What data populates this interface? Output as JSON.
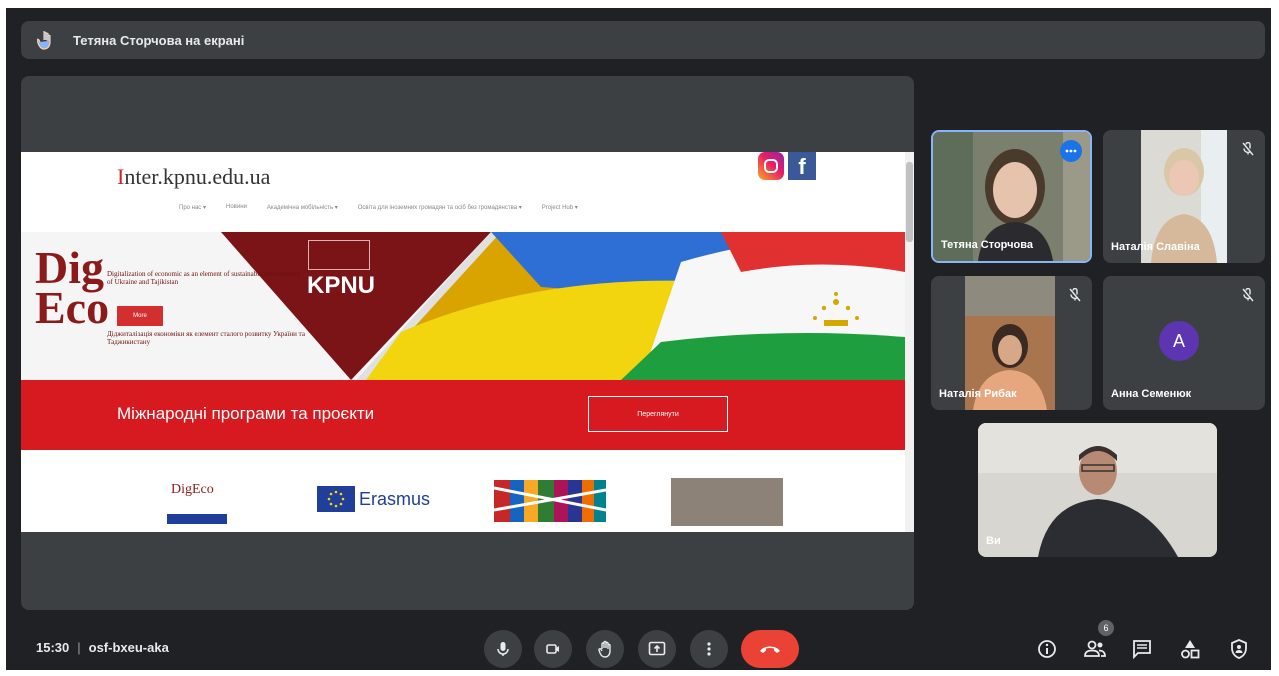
{
  "presentation": {
    "title": "Тетяна Сторчова на екрані"
  },
  "website": {
    "logo_first": "I",
    "logo_rest": "nter.kpnu.edu.ua",
    "nav": [
      "Про нас ▾",
      "Новини",
      "Академічна мобільність ▾",
      "Освіта для іноземних громадян та осіб без громадянства ▾",
      "Project Hub ▾"
    ],
    "banner": {
      "logo_line1": "Dig",
      "logo_line2": "Eco",
      "text_en": "Digitalization of economic as an element of sustainable development of Ukraine and Tajikistan",
      "more": "More",
      "text_uk": "Діджиталізація економіки як елемент сталого розвитку України та Таджикистану",
      "university": "KPNU"
    },
    "section_heading": "Міжнародні програми та проєкти",
    "view_button": "Переглянути",
    "partners": {
      "digeco": "DigEco",
      "erasmus": "Erasmus"
    }
  },
  "participants": [
    {
      "name": "Тетяна Сторчова",
      "speaking": true
    },
    {
      "name": "Наталія Славіна",
      "muted": true
    },
    {
      "name": "Наталія Рибак",
      "muted": true
    },
    {
      "name": "Анна Семенюк",
      "muted": true,
      "initial": "A"
    },
    {
      "name": "Ви"
    }
  ],
  "meeting": {
    "time": "15:30",
    "code": "osf-bxeu-aka",
    "participant_count": "6"
  },
  "colors": {
    "background": "#202124",
    "tile": "#3c4043",
    "end_call": "#ea4335",
    "active_speaker": "#8ab4f8",
    "avatar": "#5e35b1"
  }
}
